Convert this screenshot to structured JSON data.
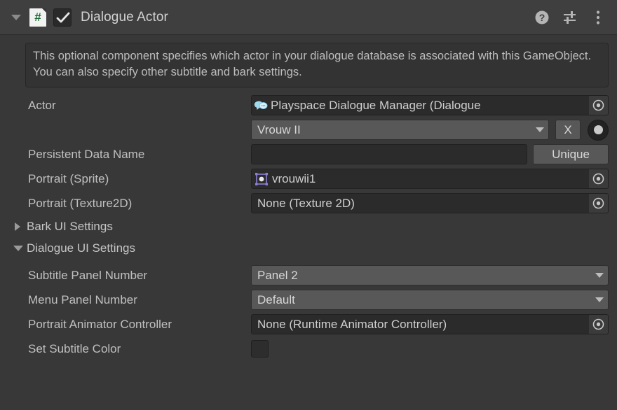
{
  "header": {
    "foldout_state": "expanded",
    "script_icon": "csharp-script-icon",
    "enabled": true,
    "title": "Dialogue Actor",
    "help_icon": "help-icon",
    "preset_icon": "preset-sliders-icon",
    "menu_icon": "more-vertical-icon"
  },
  "help_box": {
    "text": "This optional component specifies which actor in your dialogue database is associated with this GameObject. You can also specify other subtitle and bark settings."
  },
  "fields": {
    "actor": {
      "label": "Actor",
      "object_value": "Playspace Dialogue Manager (Dialogue",
      "object_icon": "dialogue-bubble-icon",
      "picker_icon": "object-picker-icon",
      "dropdown_value": "Vrouw II",
      "clear_button": "X",
      "radio_icon": "object-select-radio-icon"
    },
    "persistent_data_name": {
      "label": "Persistent Data Name",
      "value": "",
      "button": "Unique"
    },
    "portrait_sprite": {
      "label": "Portrait (Sprite)",
      "value": "vrouwii1",
      "icon": "sprite-asset-icon",
      "picker_icon": "object-picker-icon"
    },
    "portrait_texture2d": {
      "label": "Portrait (Texture2D)",
      "value": "None (Texture 2D)",
      "picker_icon": "object-picker-icon"
    },
    "bark_ui_settings": {
      "label": "Bark UI Settings",
      "expanded": false
    },
    "dialogue_ui_settings": {
      "label": "Dialogue UI Settings",
      "expanded": true
    },
    "subtitle_panel_number": {
      "label": "Subtitle Panel Number",
      "value": "Panel 2"
    },
    "menu_panel_number": {
      "label": "Menu Panel Number",
      "value": "Default"
    },
    "portrait_animator_controller": {
      "label": "Portrait Animator Controller",
      "value": "None (Runtime Animator Controller)",
      "picker_icon": "object-picker-icon"
    },
    "set_subtitle_color": {
      "label": "Set Subtitle Color",
      "checked": false
    }
  },
  "colors": {
    "background": "#383838",
    "header_bg": "#3f3f3f",
    "field_dark": "#2b2b2b",
    "popup_bg": "#585858",
    "text": "#c0c0c0",
    "script_hash": "#1d6b32",
    "sprite_icon": "#8b7fd4"
  }
}
